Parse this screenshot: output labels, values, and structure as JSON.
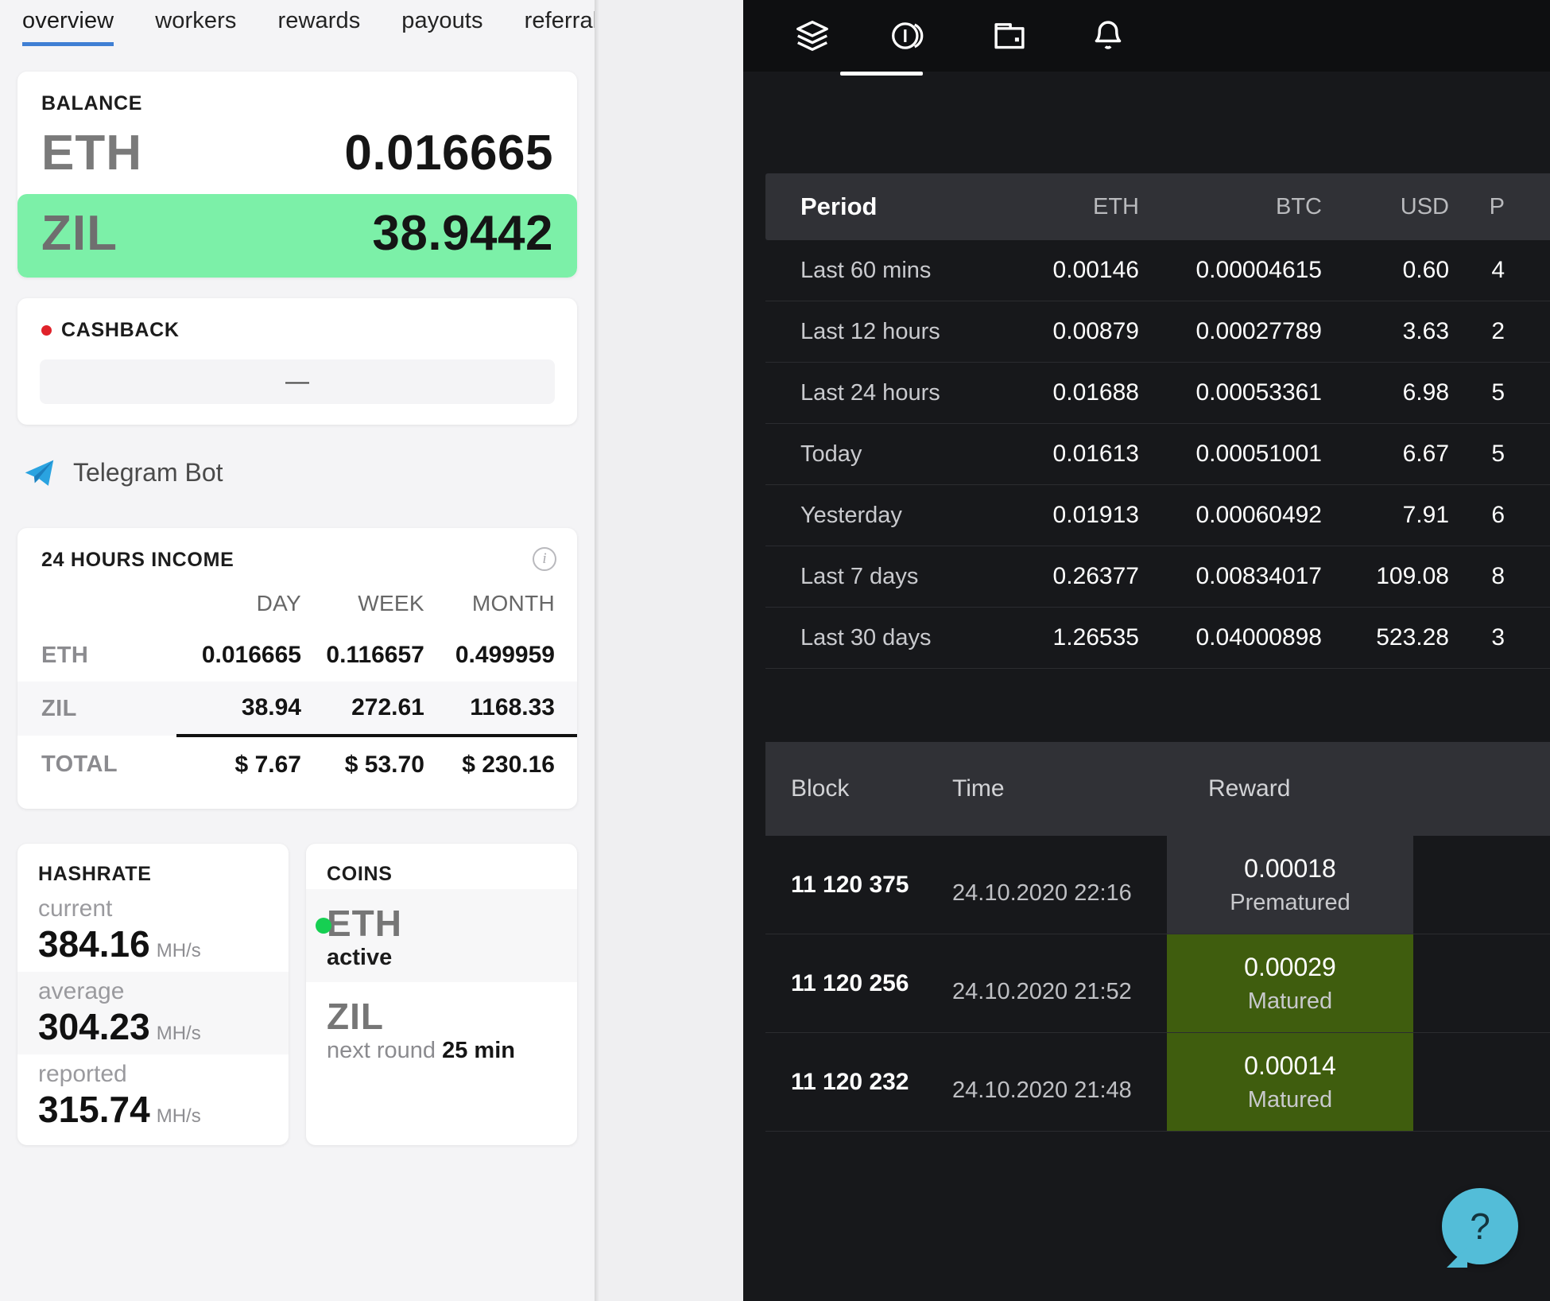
{
  "left": {
    "tabs": [
      {
        "label": "overview",
        "active": true
      },
      {
        "label": "workers",
        "active": false
      },
      {
        "label": "rewards",
        "active": false
      },
      {
        "label": "payouts",
        "active": false
      },
      {
        "label": "referral program",
        "active": false
      }
    ],
    "balance": {
      "title": "BALANCE",
      "rows": [
        {
          "symbol": "ETH",
          "value": "0.016665",
          "highlight": false
        },
        {
          "symbol": "ZIL",
          "value": "38.9442",
          "highlight": true
        }
      ],
      "highlight_color": "#7cf0a8"
    },
    "cashback": {
      "title": "CASHBACK",
      "dot_color": "#e0222a",
      "value": "—"
    },
    "telegram": {
      "label": "Telegram Bot",
      "icon": "telegram-plane-icon",
      "icon_color": "#1c92d2"
    },
    "income": {
      "title": "24 HOURS INCOME",
      "info_icon": "info-icon",
      "columns": [
        "",
        "DAY",
        "WEEK",
        "MONTH"
      ],
      "rows": [
        {
          "label": "ETH",
          "day": "0.016665",
          "week": "0.116657",
          "month": "0.499959"
        },
        {
          "label": "ZIL",
          "day": "38.94",
          "week": "272.61",
          "month": "1168.33"
        },
        {
          "label": "TOTAL",
          "day": "$ 7.67",
          "week": "$ 53.70",
          "month": "$ 230.16"
        }
      ]
    },
    "hashrate": {
      "title": "HASHRATE",
      "items": [
        {
          "label": "current",
          "value": "384.16",
          "unit": "MH/s"
        },
        {
          "label": "average",
          "value": "304.23",
          "unit": "MH/s"
        },
        {
          "label": "reported",
          "value": "315.74",
          "unit": "MH/s"
        }
      ]
    },
    "coins": {
      "title": "COINS",
      "items": [
        {
          "symbol": "ETH",
          "status": "active",
          "dot_color": "#16cf52",
          "has_dot": true
        },
        {
          "symbol": "ZIL",
          "status_prefix": "next round ",
          "status_value": "25 min",
          "has_dot": false
        }
      ]
    }
  },
  "right": {
    "topbar": {
      "icons": [
        {
          "name": "layers-icon",
          "active": false
        },
        {
          "name": "coins-icon",
          "active": true
        },
        {
          "name": "wallet-icon",
          "active": false
        },
        {
          "name": "bell-icon",
          "active": false
        }
      ]
    },
    "stats_table": {
      "columns": [
        "Period",
        "ETH",
        "BTC",
        "USD",
        "P"
      ],
      "rows": [
        {
          "period": "Last 60 mins",
          "eth": "0.00146",
          "btc": "0.00004615",
          "usd": "0.60",
          "cut": "4"
        },
        {
          "period": "Last 12 hours",
          "eth": "0.00879",
          "btc": "0.00027789",
          "usd": "3.63",
          "cut": "2"
        },
        {
          "period": "Last 24 hours",
          "eth": "0.01688",
          "btc": "0.00053361",
          "usd": "6.98",
          "cut": "5"
        },
        {
          "period": "Today",
          "eth": "0.01613",
          "btc": "0.00051001",
          "usd": "6.67",
          "cut": "5"
        },
        {
          "period": "Yesterday",
          "eth": "0.01913",
          "btc": "0.00060492",
          "usd": "7.91",
          "cut": "6"
        },
        {
          "period": "Last 7 days",
          "eth": "0.26377",
          "btc": "0.00834017",
          "usd": "109.08",
          "cut": "8"
        },
        {
          "period": "Last 30 days",
          "eth": "1.26535",
          "btc": "0.04000898",
          "usd": "523.28",
          "cut": "3"
        }
      ]
    },
    "blocks_table": {
      "columns": [
        "Block",
        "Time",
        "Reward"
      ],
      "rows": [
        {
          "block": "11 120 375",
          "time": "24.10.2020 22:16",
          "reward": "0.00018",
          "state": "Prematured",
          "state_kind": "premature"
        },
        {
          "block": "11 120 256",
          "time": "24.10.2020 21:52",
          "reward": "0.00029",
          "state": "Matured",
          "state_kind": "matured"
        },
        {
          "block": "11 120 232",
          "time": "24.10.2020 21:48",
          "reward": "0.00014",
          "state": "Matured",
          "state_kind": "matured"
        }
      ],
      "matured_color": "#3f5d0e",
      "premature_color": "#303136"
    },
    "help_button": {
      "icon": "question-mark-icon",
      "label": "?",
      "color": "#53bdd8"
    }
  }
}
